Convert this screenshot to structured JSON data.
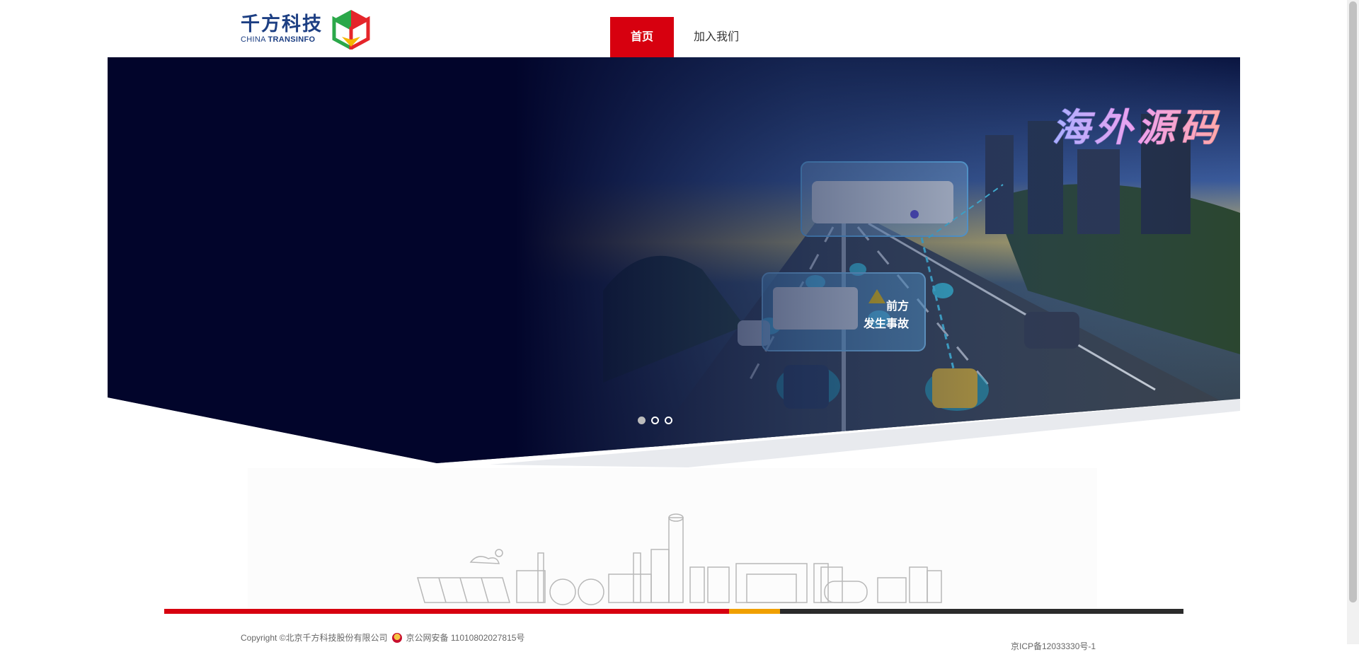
{
  "logo": {
    "cn": "千方科技",
    "en_prefix": "CHINA ",
    "en_bold": "TRANSINFO"
  },
  "nav": {
    "items": [
      {
        "label": "首页",
        "active": true
      },
      {
        "label": "加入我们",
        "active": false
      }
    ]
  },
  "banner": {
    "watermark": "海外源码",
    "callout_line1": "前方",
    "callout_line2": "发生事故",
    "slides_total": 3,
    "slide_active": 1
  },
  "footer": {
    "copyright": "Copyright ©北京千方科技股份有限公司",
    "police_record": "京公网安备 11010802027815号",
    "icp": "京ICP备12033330号-1"
  },
  "colors": {
    "accent": "#d7000f",
    "brand": "#1d3f83",
    "banner_bg": "#02052b"
  }
}
